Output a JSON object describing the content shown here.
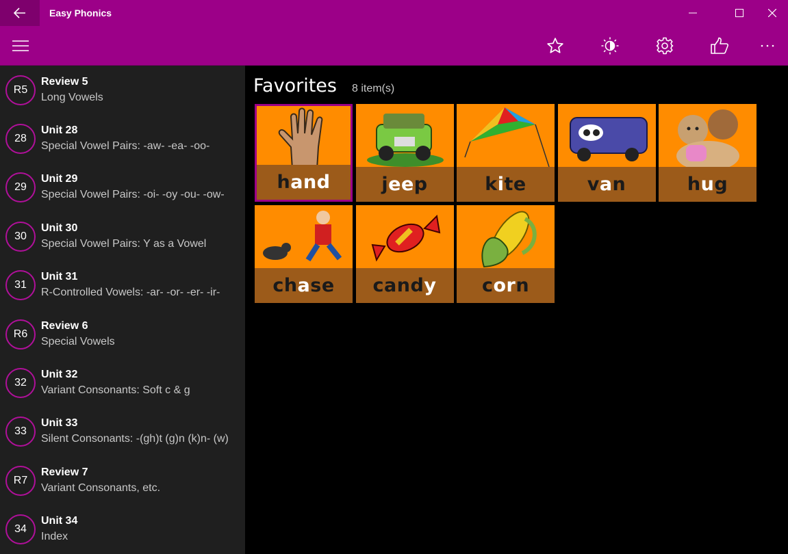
{
  "app": {
    "title": "Easy Phonics"
  },
  "sidebar": {
    "items": [
      {
        "badge": "R5",
        "title": "Review 5",
        "subtitle": "Long Vowels"
      },
      {
        "badge": "28",
        "title": "Unit 28",
        "subtitle": "Special Vowel Pairs: -aw- -ea- -oo-"
      },
      {
        "badge": "29",
        "title": "Unit 29",
        "subtitle": "Special Vowel Pairs: -oi- -oy -ou- -ow-"
      },
      {
        "badge": "30",
        "title": "Unit 30",
        "subtitle": "Special Vowel Pairs: Y as a Vowel"
      },
      {
        "badge": "31",
        "title": "Unit 31",
        "subtitle": "R-Controlled Vowels: -ar- -or- -er- -ir-"
      },
      {
        "badge": "R6",
        "title": "Review 6",
        "subtitle": "Special Vowels"
      },
      {
        "badge": "32",
        "title": "Unit 32",
        "subtitle": "Variant Consonants: Soft c & g"
      },
      {
        "badge": "33",
        "title": "Unit 33",
        "subtitle": "Silent Consonants: -(gh)t (g)n (k)n- (w)"
      },
      {
        "badge": "R7",
        "title": "Review 7",
        "subtitle": "Variant Consonants, etc."
      },
      {
        "badge": "34",
        "title": "Unit 34",
        "subtitle": "Index"
      }
    ]
  },
  "main": {
    "title": "Favorites",
    "count": "8 item(s)",
    "tiles": [
      {
        "pre": "h",
        "hi": "and",
        "post": "",
        "icon": "hand-picture"
      },
      {
        "pre": "j",
        "hi": "ee",
        "post": "p",
        "icon": "jeep-picture"
      },
      {
        "pre": "k",
        "hi": "i",
        "post": "te",
        "icon": "kite-picture"
      },
      {
        "pre": "v",
        "hi": "a",
        "post": "n",
        "icon": "van-picture"
      },
      {
        "pre": "h",
        "hi": "u",
        "post": "g",
        "icon": "hug-picture"
      },
      {
        "pre": "ch",
        "hi": "a",
        "post": "se",
        "icon": "chase-picture"
      },
      {
        "pre": "cand",
        "hi": "y",
        "post": "",
        "icon": "candy-picture"
      },
      {
        "pre": "c",
        "hi": "or",
        "post": "n",
        "icon": "corn-picture"
      }
    ]
  },
  "colors": {
    "accent": "#9c0088",
    "tile": "#ff8c00",
    "band": "#9c5b1a",
    "sidebar": "#1f1f1f"
  }
}
